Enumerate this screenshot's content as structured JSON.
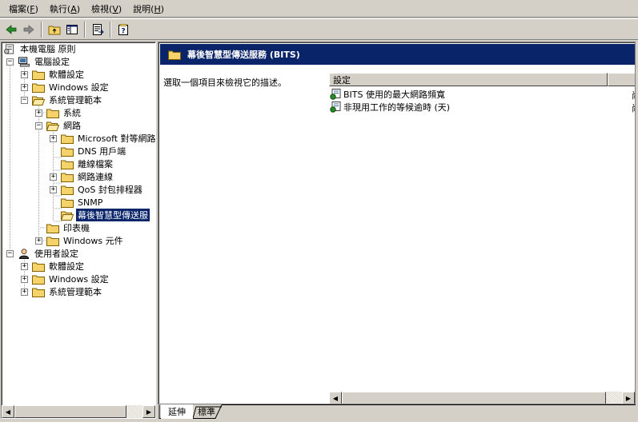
{
  "menu": {
    "items": [
      {
        "label": "檔案(",
        "key": "F",
        "suffix": ")"
      },
      {
        "label": "執行(",
        "key": "A",
        "suffix": ")"
      },
      {
        "label": "檢視(",
        "key": "V",
        "suffix": ")"
      },
      {
        "label": "說明(",
        "key": "H",
        "suffix": ")"
      }
    ]
  },
  "toolbar": {
    "buttons": [
      "back-arrow-icon",
      "forward-arrow-icon",
      "up-folder-icon",
      "show-hide-tree-icon",
      "export-list-icon",
      "help-icon"
    ]
  },
  "tree": {
    "root": "本機電腦 原則",
    "computer_config": "電腦設定",
    "software_settings": "軟體設定",
    "windows_settings": "Windows 設定",
    "admin_templates": "系統管理範本",
    "system": "系統",
    "network": "網路",
    "microsoft_p2p": "Microsoft 對等網路",
    "dns_client": "DNS 用戶端",
    "offline_files": "離線檔案",
    "network_connections": "網路連線",
    "qos": "QoS 封包排程器",
    "snmp": "SNMP",
    "bits": "幕後智慧型傳送服",
    "printers": "印表機",
    "windows_components": "Windows 元件",
    "user_config": "使用者設定",
    "user_software_settings": "軟體設定",
    "user_windows_settings": "Windows 設定",
    "user_admin_templates": "系統管理範本"
  },
  "right": {
    "header_title": "幕後智慧型傳送服務 (BITS)",
    "description": "選取一個項目來檢視它的描述。",
    "column_setting": "設定",
    "rows": [
      {
        "label": "BITS 使用的最大網路頻寬",
        "edge": "尚"
      },
      {
        "label": "非現用工作的等候逾時 (天)",
        "edge": "尚"
      }
    ]
  },
  "tabs": {
    "extended": "延伸",
    "standard": "標準"
  },
  "colors": {
    "selection": "#0a246a",
    "window_bg": "#d4d0c8",
    "folder": "#f6d36a"
  }
}
